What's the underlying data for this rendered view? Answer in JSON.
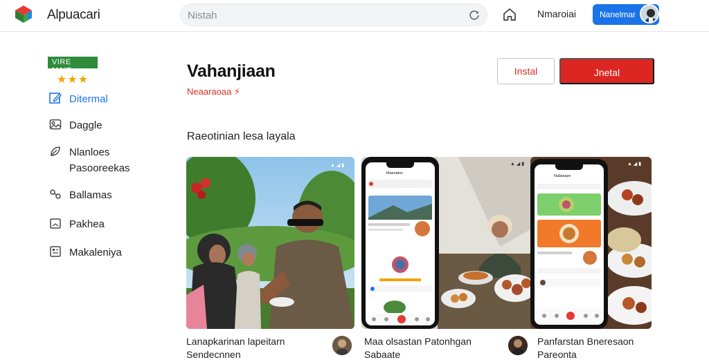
{
  "header": {
    "brand": "Alpuacari",
    "search_placeholder": "Nistah",
    "account_name": "Nmaroiai",
    "profile_button_label": "Nanelmar"
  },
  "sidebar": {
    "badge": "VIRE MAIE",
    "rating_stars": "★★★",
    "rating_value": 3,
    "items": [
      {
        "label": "Ditermal",
        "icon": "edit-icon"
      },
      {
        "label": "Daggle",
        "icon": "gallery-icon"
      },
      {
        "label": "Nlanloes",
        "icon": "leaf-icon"
      },
      {
        "label": "Pasooreekas",
        "icon": ""
      },
      {
        "label": "Ballamas",
        "icon": "link-icon"
      },
      {
        "label": "Pakhea",
        "icon": "photo-icon"
      },
      {
        "label": "Makaleniya",
        "icon": "grid-icon"
      }
    ]
  },
  "main": {
    "app_title": "Vahanjiaan",
    "app_subtitle": "Neaaraoaa ⚡",
    "install_outline_label": "Instal",
    "install_primary_label": "Jnetal",
    "section_title": "Raeotinian lesa layala",
    "phone1": {
      "app_name": "Maenidnn"
    },
    "phone2": {
      "app_name": "Nalaiaaye"
    },
    "captions": [
      {
        "line1": "Lanapkarinan lapeitarn",
        "line2": "Sendecnnen"
      },
      {
        "line1": "Maa olsastan Patonhgan",
        "line2": "Sabaate"
      },
      {
        "line1": "Panfarstan Bneresaon",
        "line2": "Pareonta"
      }
    ]
  },
  "colors": {
    "accent_red": "#dc2622",
    "link_blue": "#1a73e8",
    "badge_green": "#2e8b3a",
    "star_gold": "#f4a300"
  }
}
